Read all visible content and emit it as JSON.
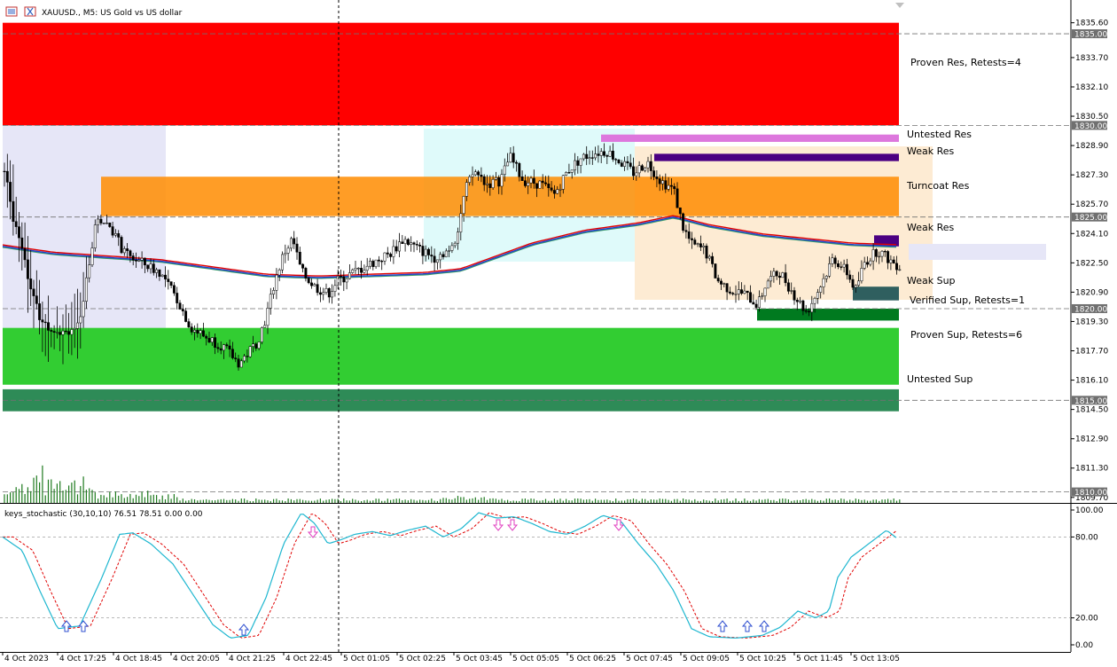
{
  "header": {
    "title": "XAUUSD., M5:  US Gold vs US dollar",
    "menu_icon": "chart-menu-icon",
    "window_icon": "window-icon"
  },
  "zones": [
    {
      "label": "Proven Res, Retests=4",
      "top": 1835.6,
      "bottom": 1830.0,
      "color": "#ff0000"
    },
    {
      "label": "Untested Res",
      "top": 1829.5,
      "bottom": 1829.1,
      "color": "#dd77dd"
    },
    {
      "label": "Weak Res",
      "top": 1828.45,
      "bottom": 1828.05,
      "color": "#4b0082"
    },
    {
      "label": "Turncoat Res",
      "top": 1827.2,
      "bottom": 1825.05,
      "color": "#ff8c00"
    },
    {
      "label": "Weak Res",
      "top": 1824.0,
      "bottom": 1823.4,
      "color": "#4b0082"
    },
    {
      "label": "Weak Sup",
      "top": 1821.2,
      "bottom": 1820.45,
      "color": "#2f5f5f"
    },
    {
      "label": "Verified Sup, Retests=1",
      "top": 1820.0,
      "bottom": 1819.35,
      "color": "#007a1f"
    },
    {
      "label": "Proven Sup, Retests=6",
      "top": 1818.95,
      "bottom": 1815.85,
      "color": "#32cd32"
    },
    {
      "label": "Untested Sup",
      "top": 1815.6,
      "bottom": 1814.4,
      "color": "#2e8b57"
    }
  ],
  "price_axis": {
    "ticks": [
      "1835.60",
      "1833.70",
      "1832.10",
      "1830.50",
      "1828.90",
      "1827.30",
      "1825.70",
      "1824.10",
      "1822.50",
      "1820.90",
      "1819.30",
      "1817.70",
      "1816.10",
      "1814.50",
      "1812.90",
      "1811.30",
      "1809.70"
    ],
    "tick_values": [
      1835.6,
      1833.7,
      1832.1,
      1830.5,
      1828.9,
      1827.3,
      1825.7,
      1824.1,
      1822.5,
      1820.9,
      1819.3,
      1817.7,
      1816.1,
      1814.5,
      1812.9,
      1811.3,
      1809.7
    ],
    "level_labels": [
      "1835.00",
      "1830.00",
      "1825.00",
      "1820.00",
      "1815.00",
      "1810.00"
    ],
    "level_values": [
      1835.0,
      1830.0,
      1825.0,
      1820.0,
      1815.0,
      1810.0
    ],
    "range": [
      1809.4,
      1836.6
    ]
  },
  "time_axis": [
    "4 Oct 2023",
    "4 Oct 17:25",
    "4 Oct 18:45",
    "4 Oct 20:05",
    "4 Oct 21:25",
    "4 Oct 22:45",
    "5 Oct 01:05",
    "5 Oct 02:25",
    "5 Oct 03:45",
    "5 Oct 05:05",
    "5 Oct 06:25",
    "5 Oct 07:45",
    "5 Oct 09:05",
    "5 Oct 10:25",
    "5 Oct 11:45",
    "5 Oct 13:05"
  ],
  "indicator": {
    "label": "keys_stochastic (30,10,10) 76.51 78.51 0.00 0.00",
    "ticks": [
      "100.00",
      "80.00",
      "20.00",
      "0.00"
    ],
    "tick_values": [
      100,
      80,
      20,
      0
    ],
    "main_value": 76.51,
    "signal_value": 78.51,
    "main_color": "#1fb7d0",
    "signal_color": "#e00000"
  },
  "colors": {
    "bull_candle": "#000000",
    "ma_red": "#e00000",
    "ma_blue": "#1f3fd0",
    "ma_green": "#3a9a6a",
    "volume": "#1e7a1e"
  }
}
